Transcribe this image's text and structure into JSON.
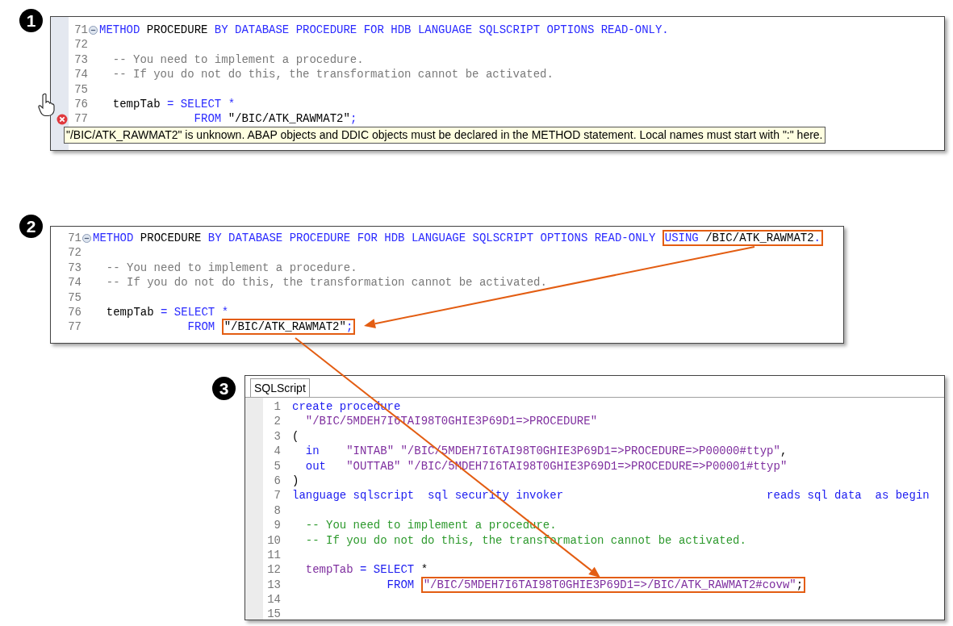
{
  "figures": [
    {
      "badge": "1",
      "kind": "abap",
      "lines": [
        {
          "number": "71",
          "collapsible": true,
          "error": false,
          "tokens": [
            {
              "text": "METHOD",
              "kind": "keyword"
            },
            {
              "text": " PROCEDURE ",
              "kind": "plain"
            },
            {
              "text": "BY DATABASE PROCEDURE FOR HDB LANGUAGE SQLSCRIPT OPTIONS READ-ONLY.",
              "kind": "keyword"
            }
          ]
        },
        {
          "number": "72",
          "collapsible": false,
          "error": false
        },
        {
          "number": "73",
          "collapsible": false,
          "error": false,
          "tokens": [
            {
              "text": "  -- You need to implement a procedure.",
              "kind": "comment"
            }
          ]
        },
        {
          "number": "74",
          "collapsible": false,
          "error": false,
          "tokens": [
            {
              "text": "  -- If you do not do this, the transformation cannot be activated.",
              "kind": "comment"
            }
          ]
        },
        {
          "number": "75",
          "collapsible": false,
          "error": false
        },
        {
          "number": "76",
          "collapsible": false,
          "error": false,
          "tokens": [
            {
              "text": "  tempTab",
              "kind": "plain"
            },
            {
              "text": " = SELECT *",
              "kind": "keyword"
            }
          ]
        },
        {
          "number": "77",
          "collapsible": false,
          "error": true,
          "tokens": [
            {
              "text": "              FROM ",
              "kind": "keyword"
            },
            {
              "text": "\"/BIC/ATK_RAWMAT2\"",
              "kind": "string"
            },
            {
              "text": ";",
              "kind": "keyword"
            }
          ]
        }
      ],
      "tooltip": "\"/BIC/ATK_RAWMAT2\" is unknown. ABAP objects and DDIC objects must be declared in the METHOD statement. Local names must start with \":\" here."
    },
    {
      "badge": "2",
      "kind": "abap",
      "lines": [
        {
          "number": "71",
          "collapsible": true,
          "error": false,
          "tokens": [
            {
              "text": "METHOD",
              "kind": "keyword"
            },
            {
              "text": " PROCEDURE ",
              "kind": "plain"
            },
            {
              "text": "BY DATABASE PROCEDURE FOR HDB LANGUAGE SQLSCRIPT OPTIONS READ-ONLY ",
              "kind": "keyword"
            },
            {
              "text": "USING",
              "kind": "keyword",
              "boxed": true
            },
            {
              "text": " /BIC/ATK_RAWMAT2",
              "kind": "plain",
              "boxed": true
            },
            {
              "text": ".",
              "kind": "keyword",
              "boxed": true
            }
          ]
        },
        {
          "number": "72",
          "collapsible": false,
          "error": false
        },
        {
          "number": "73",
          "collapsible": false,
          "error": false,
          "tokens": [
            {
              "text": "  -- You need to implement a procedure.",
              "kind": "comment"
            }
          ]
        },
        {
          "number": "74",
          "collapsible": false,
          "error": false,
          "tokens": [
            {
              "text": "  -- If you do not do this, the transformation cannot be activated.",
              "kind": "comment"
            }
          ]
        },
        {
          "number": "75",
          "collapsible": false,
          "error": false
        },
        {
          "number": "76",
          "collapsible": false,
          "error": false,
          "tokens": [
            {
              "text": "  tempTab",
              "kind": "plain"
            },
            {
              "text": " = SELECT *",
              "kind": "keyword"
            }
          ]
        },
        {
          "number": "77",
          "collapsible": false,
          "error": false,
          "tokens": [
            {
              "text": "              FROM ",
              "kind": "keyword"
            },
            {
              "text": "\"/BIC/ATK_RAWMAT2\"",
              "kind": "string",
              "boxed": true
            },
            {
              "text": ";",
              "kind": "keyword",
              "boxed": true
            }
          ]
        }
      ]
    },
    {
      "badge": "3",
      "kind": "sqlscript",
      "tab": {
        "label": "SQLScript",
        "selected": true
      },
      "lines": [
        {
          "number": "1",
          "tokens": [
            {
              "text": "create procedure",
              "kind": "keyword"
            }
          ]
        },
        {
          "number": "2",
          "tokens": [
            {
              "text": "  \"/BIC/5MDEH7I6TAI98T0GHIE3P69D1=>PROCEDURE\"",
              "kind": "string"
            }
          ]
        },
        {
          "number": "3",
          "tokens": [
            {
              "text": "(",
              "kind": "plain"
            }
          ]
        },
        {
          "number": "4",
          "tokens": [
            {
              "text": "  in    ",
              "kind": "keyword"
            },
            {
              "text": "\"INTAB\" \"/BIC/5MDEH7I6TAI98T0GHIE3P69D1=>PROCEDURE=>P00000#ttyp\"",
              "kind": "string"
            },
            {
              "text": ",",
              "kind": "plain"
            }
          ]
        },
        {
          "number": "5",
          "tokens": [
            {
              "text": "  out   ",
              "kind": "keyword"
            },
            {
              "text": "\"OUTTAB\" \"/BIC/5MDEH7I6TAI98T0GHIE3P69D1=>PROCEDURE=>P00001#ttyp\"",
              "kind": "string"
            }
          ]
        },
        {
          "number": "6",
          "tokens": [
            {
              "text": ")",
              "kind": "plain"
            }
          ]
        },
        {
          "number": "7",
          "tokens": [
            {
              "text": "language sqlscript  sql security invoker                              reads sql data  as begin",
              "kind": "keyword"
            }
          ]
        },
        {
          "number": "8"
        },
        {
          "number": "9",
          "tokens": [
            {
              "text": "  -- You need to implement a procedure.",
              "kind": "comment"
            }
          ]
        },
        {
          "number": "10",
          "tokens": [
            {
              "text": "  -- If you do not do this, the transformation cannot be activated.",
              "kind": "comment"
            }
          ]
        },
        {
          "number": "11"
        },
        {
          "number": "12",
          "tokens": [
            {
              "text": "  tempTab",
              "kind": "variable"
            },
            {
              "text": " = SELECT",
              "kind": "keyword"
            },
            {
              "text": " *",
              "kind": "plain"
            }
          ]
        },
        {
          "number": "13",
          "tokens": [
            {
              "text": "              FROM ",
              "kind": "keyword"
            },
            {
              "text": "\"/BIC/5MDEH7I6TAI98T0GHIE3P69D1=>/BIC/ATK_RAWMAT2#covw\"",
              "kind": "string",
              "boxed": true
            },
            {
              "text": ";",
              "kind": "plain",
              "boxed": true
            }
          ]
        },
        {
          "number": "14"
        },
        {
          "number": "15"
        }
      ]
    }
  ]
}
